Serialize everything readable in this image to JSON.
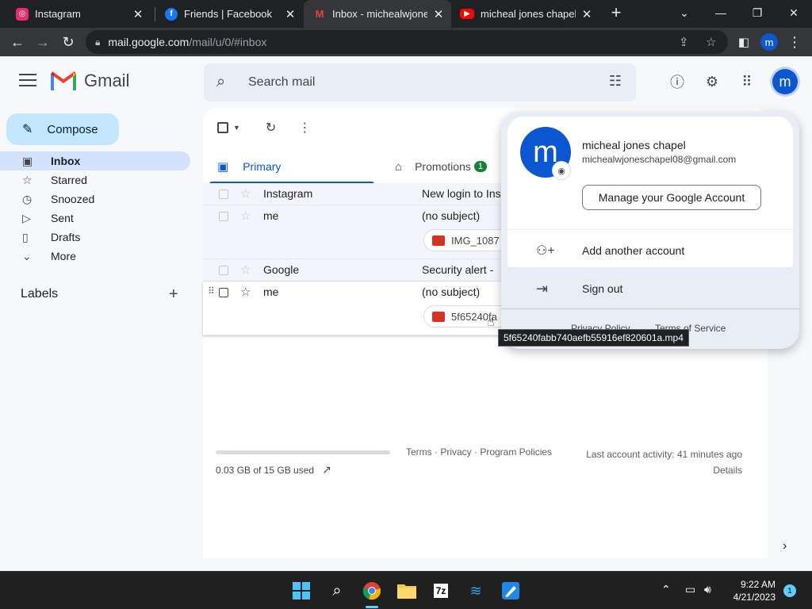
{
  "browser": {
    "tabs": [
      {
        "title": "Instagram",
        "favicon_color": "#e1306c"
      },
      {
        "title": "Friends | Facebook",
        "favicon_color": "#1877f2"
      },
      {
        "title": "Inbox - michealwjonesc",
        "favicon_color": "#ea4335"
      },
      {
        "title": "micheal jones chapel -",
        "favicon_color": "#ff0000"
      }
    ],
    "close_glyph": "✕",
    "new_tab_glyph": "+",
    "url_host": "mail.google.com",
    "url_path": "/mail/u/0/#inbox",
    "profile_initial": "m"
  },
  "gmail": {
    "brand": "Gmail",
    "search_placeholder": "Search mail",
    "avatar_initial": "m",
    "compose_label": "Compose",
    "nav": [
      {
        "label": "Inbox",
        "icon": "inbox-icon",
        "active": true
      },
      {
        "label": "Starred",
        "icon": "star-icon"
      },
      {
        "label": "Snoozed",
        "icon": "clock-icon"
      },
      {
        "label": "Sent",
        "icon": "send-icon"
      },
      {
        "label": "Drafts",
        "icon": "draft-icon"
      },
      {
        "label": "More",
        "icon": "chevron-down-icon"
      }
    ],
    "labels_heading": "Labels",
    "tabs": {
      "primary": "Primary",
      "promotions": "Promotions",
      "promotions_badge": "1"
    },
    "rows": [
      {
        "sender": "Instagram",
        "subject": "New login to Ins"
      },
      {
        "sender": "me",
        "subject": "(no subject)",
        "attachment": "IMG_1087"
      },
      {
        "sender": "Google",
        "subject": "Security alert -"
      },
      {
        "sender": "me",
        "subject": "(no subject)",
        "attachment": "5f65240fa"
      }
    ],
    "storage": "0.03 GB of 15 GB used",
    "footer_links": "Terms · Privacy · Program Policies",
    "last_activity": "Last account activity: 41 minutes ago",
    "details": "Details"
  },
  "account_popup": {
    "initial": "m",
    "name": "micheal jones chapel",
    "email": "michealwjoneschapel08@gmail.com",
    "manage": "Manage your Google Account",
    "add_account": "Add another account",
    "sign_out": "Sign out",
    "privacy_policy": "Privacy Policy",
    "terms": "Terms of Service"
  },
  "tooltip": "5f65240fabb740aefb55916ef820601a.mp4",
  "taskbar": {
    "time": "9:22 AM",
    "date": "4/21/2023",
    "notifications": "1",
    "app_7z_label": "7z"
  }
}
